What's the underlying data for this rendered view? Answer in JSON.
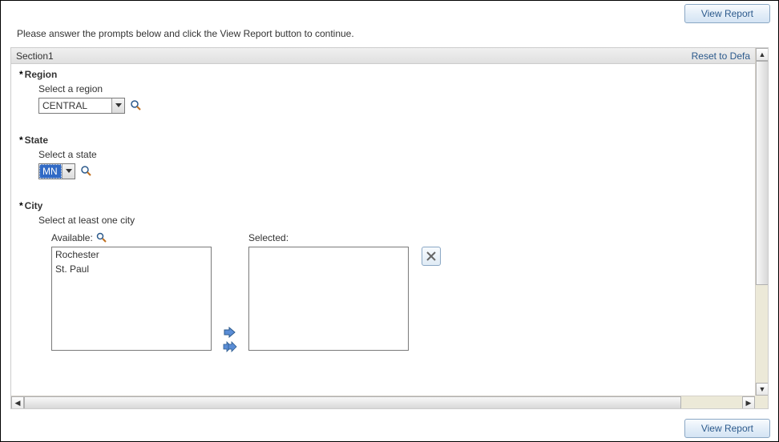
{
  "buttons": {
    "view_report": "View Report"
  },
  "instruction": "Please answer the prompts below and click the View Report button to continue.",
  "section": {
    "title": "Section1",
    "reset": "Reset to Defa"
  },
  "region": {
    "label": "Region",
    "sub": "Select a region",
    "value": "CENTRAL"
  },
  "state": {
    "label": "State",
    "sub": "Select a state",
    "value": "MN"
  },
  "city": {
    "label": "City",
    "sub": "Select at least one city",
    "available_label": "Available:",
    "selected_label": "Selected:",
    "available": [
      "Rochester",
      "St. Paul"
    ],
    "selected": []
  }
}
